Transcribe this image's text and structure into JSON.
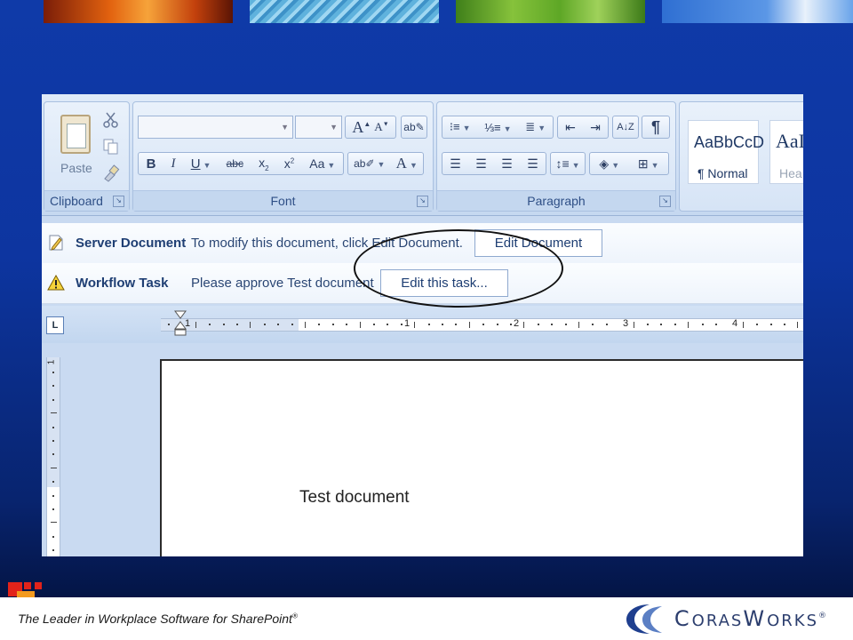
{
  "slide": {
    "footer_text": "The Leader in Workplace Software for SharePoint",
    "footer_trademark": "®",
    "brand_name_first": "C",
    "brand_name_rest": "ORAS",
    "brand_name_second": "W",
    "brand_name_tail": "ORKS",
    "brand_trademark": "®"
  },
  "ribbon": {
    "clipboard": {
      "paste_label": "Paste",
      "group_label": "Clipboard"
    },
    "font": {
      "group_label": "Font",
      "font_name": "",
      "font_size": ""
    },
    "paragraph": {
      "group_label": "Paragraph"
    },
    "styles": [
      {
        "sample": "AaBbCcD",
        "name": "¶ Normal"
      },
      {
        "sample": "AaI",
        "name": "Hea"
      }
    ]
  },
  "infobars": [
    {
      "title": "Server Document",
      "message": "To modify this document, click Edit Document.",
      "button": "Edit Document"
    },
    {
      "title": "Workflow Task",
      "message": "Please approve Test document",
      "button": "Edit this task..."
    }
  ],
  "ruler": {
    "h_numbers": [
      "1",
      "1",
      "2",
      "3",
      "4"
    ],
    "v_numbers": [
      "1"
    ]
  },
  "document": {
    "body_text": "Test document"
  },
  "colors": {
    "slide_blue": "#0f3aa8",
    "ribbon": "#cfdff4",
    "brand": "#2c3e6e"
  },
  "icons": [
    "cut-icon",
    "copy-icon",
    "format-painter-icon",
    "warning-icon",
    "document-edit-icon"
  ]
}
